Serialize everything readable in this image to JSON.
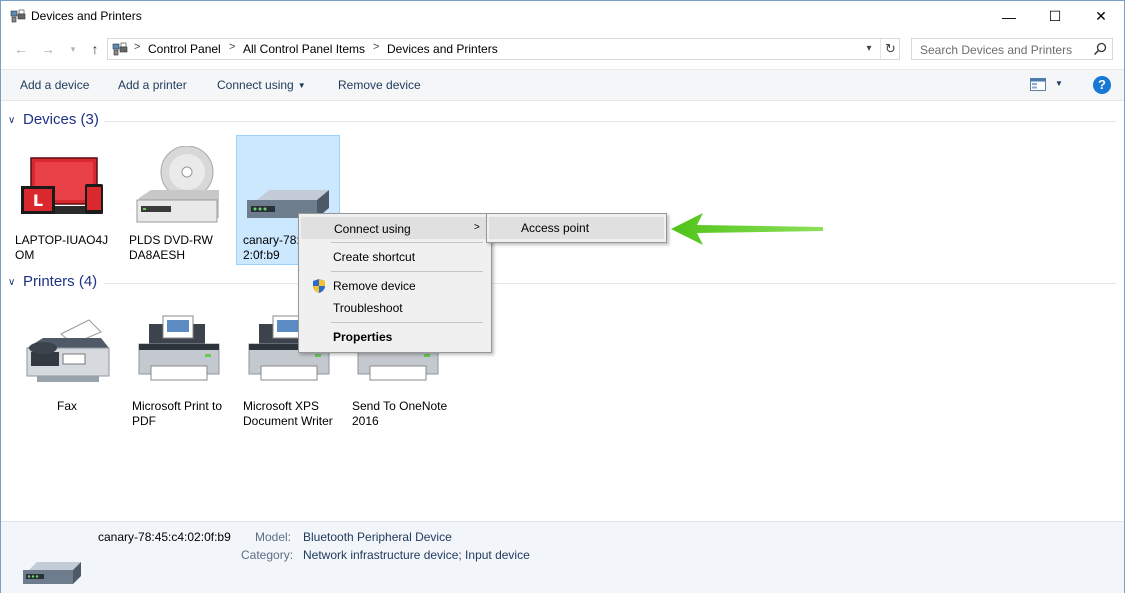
{
  "window": {
    "title": "Devices and Printers",
    "controls": {
      "minimize": "—",
      "maximize": "☐",
      "close": "✕"
    }
  },
  "nav": {
    "back": "←",
    "forward": "→",
    "recent": "▾",
    "up": "↑",
    "breadcrumbs": [
      "Control Panel",
      "All Control Panel Items",
      "Devices and Printers"
    ],
    "separator": ">",
    "dropdown": "▾",
    "refresh": "↻"
  },
  "search": {
    "placeholder": "Search Devices and Printers"
  },
  "toolbar": {
    "add_device": "Add a device",
    "add_printer": "Add a printer",
    "connect_using": "Connect using",
    "caret": "▼",
    "remove_device": "Remove device",
    "view_caret": "▼",
    "help": "?"
  },
  "groups": {
    "devices": {
      "title": "Devices (3)",
      "chevron": "∨",
      "items": [
        {
          "label": "LAPTOP-IUAO4J OM",
          "icon": "laptop-icon"
        },
        {
          "label": "PLDS DVD-RW DA8AESH",
          "icon": "dvd-drive-icon"
        },
        {
          "label": "canary-78:45:c4:02:0f:b9",
          "icon": "network-device-icon",
          "selected": true
        }
      ]
    },
    "printers": {
      "title": "Printers (4)",
      "chevron": "∨",
      "items": [
        {
          "label": "Fax",
          "icon": "fax-icon"
        },
        {
          "label": "Microsoft Print to PDF",
          "icon": "printer-icon"
        },
        {
          "label": "Microsoft XPS Document Writer",
          "icon": "printer-icon"
        },
        {
          "label": "Send To OneNote 2016",
          "icon": "printer-icon"
        }
      ]
    }
  },
  "tiles": {
    "laptop_label_1": "LAPTOP-IUAO4J",
    "laptop_label_2": "OM",
    "dvd_label_1": "PLDS DVD-RW",
    "dvd_label_2": "DA8AESH",
    "canary_label_1": "canary-78:",
    "canary_label_2": "2:0f:b9",
    "fax_label": "Fax",
    "pdf_label_1": "Microsoft Print to",
    "pdf_label_2": "PDF",
    "xps_label_1": "Microsoft XPS",
    "xps_label_2": "Document Writer",
    "onenote_label_1": "Send To OneNote",
    "onenote_label_2": "2016"
  },
  "context_menu": {
    "items": {
      "connect_using": "Connect using",
      "create_shortcut": "Create shortcut",
      "remove_device": "Remove device",
      "troubleshoot": "Troubleshoot",
      "properties": "Properties"
    },
    "submenu_arrow": ">",
    "submenu": {
      "access_point": "Access point"
    }
  },
  "details": {
    "name": "canary-78:45:c4:02:0f:b9",
    "model_key": "Model:",
    "model_val": "Bluetooth Peripheral Device",
    "category_key": "Category:",
    "category_val": "Network infrastructure device; Input device"
  },
  "colors": {
    "accent": "#1e3287",
    "selection": "#cce8ff",
    "arrow": "#5ac81e",
    "laptop_red": "#d9282e"
  }
}
